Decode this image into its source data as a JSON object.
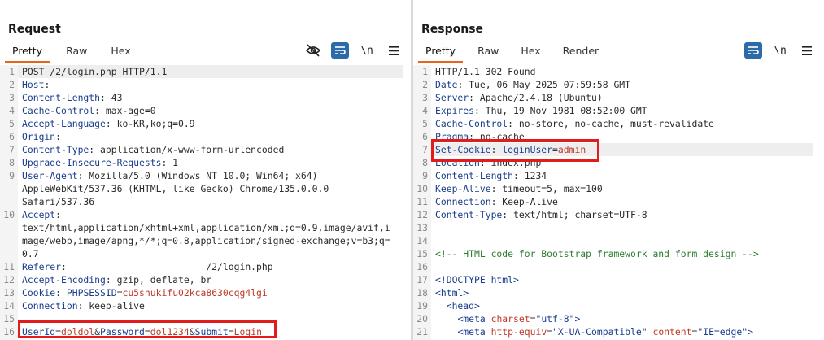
{
  "request": {
    "title": "Request",
    "tabs": [
      "Pretty",
      "Raw",
      "Hex"
    ],
    "active_tab": "Pretty",
    "newline_label": "\\n",
    "lines": [
      {
        "n": "1",
        "parts": [
          [
            "v",
            "POST /2/login.php HTTP/1.1"
          ]
        ]
      },
      {
        "n": "2",
        "parts": [
          [
            "k",
            "Host"
          ],
          [
            "v",
            ":"
          ]
        ]
      },
      {
        "n": "3",
        "parts": [
          [
            "k",
            "Content-Length"
          ],
          [
            "v",
            ": 43"
          ]
        ]
      },
      {
        "n": "4",
        "parts": [
          [
            "k",
            "Cache-Control"
          ],
          [
            "v",
            ": max-age=0"
          ]
        ]
      },
      {
        "n": "5",
        "parts": [
          [
            "k",
            "Accept-Language"
          ],
          [
            "v",
            ": ko-KR,ko;q=0.9"
          ]
        ]
      },
      {
        "n": "6",
        "parts": [
          [
            "k",
            "Origin"
          ],
          [
            "v",
            ":"
          ]
        ]
      },
      {
        "n": "7",
        "parts": [
          [
            "k",
            "Content-Type"
          ],
          [
            "v",
            ": application/x-www-form-urlencoded"
          ]
        ]
      },
      {
        "n": "8",
        "parts": [
          [
            "k",
            "Upgrade-Insecure-Requests"
          ],
          [
            "v",
            ": 1"
          ]
        ]
      },
      {
        "n": "9",
        "parts": [
          [
            "k",
            "User-Agent"
          ],
          [
            "v",
            ": Mozilla/5.0 (Windows NT 10.0; Win64; x64)"
          ]
        ]
      },
      {
        "n": "",
        "parts": [
          [
            "v",
            "AppleWebKit/537.36 (KHTML, like Gecko) Chrome/135.0.0.0"
          ]
        ]
      },
      {
        "n": "",
        "parts": [
          [
            "v",
            "Safari/537.36"
          ]
        ]
      },
      {
        "n": "10",
        "parts": [
          [
            "k",
            "Accept"
          ],
          [
            "v",
            ":"
          ]
        ]
      },
      {
        "n": "",
        "parts": [
          [
            "v",
            "text/html,application/xhtml+xml,application/xml;q=0.9,image/avif,i"
          ]
        ]
      },
      {
        "n": "",
        "parts": [
          [
            "v",
            "mage/webp,image/apng,*/*;q=0.8,application/signed-exchange;v=b3;q="
          ]
        ]
      },
      {
        "n": "",
        "parts": [
          [
            "v",
            "0.7"
          ]
        ]
      },
      {
        "n": "11",
        "parts": [
          [
            "k",
            "Referer"
          ],
          [
            "v",
            ":                         /2/login.php"
          ]
        ]
      },
      {
        "n": "12",
        "parts": [
          [
            "k",
            "Accept-Encoding"
          ],
          [
            "v",
            ": gzip, deflate, br"
          ]
        ]
      },
      {
        "n": "13",
        "parts": [
          [
            "k",
            "Cookie"
          ],
          [
            "v",
            ": "
          ],
          [
            "ck",
            "PHPSESSID"
          ],
          [
            "eq",
            "="
          ],
          [
            "cv",
            "cu5snukifu02kca8630cqg4lgi"
          ]
        ]
      },
      {
        "n": "14",
        "parts": [
          [
            "k",
            "Connection"
          ],
          [
            "v",
            ": keep-alive"
          ]
        ]
      },
      {
        "n": "15",
        "parts": []
      },
      {
        "n": "16",
        "parts": [
          [
            "pk",
            "UserId"
          ],
          [
            "eq",
            "="
          ],
          [
            "pv",
            "doldol"
          ],
          [
            "eq",
            "&"
          ],
          [
            "pk",
            "Password"
          ],
          [
            "eq",
            "="
          ],
          [
            "pv",
            "dol1234"
          ],
          [
            "eq",
            "&"
          ],
          [
            "pk",
            "Submit"
          ],
          [
            "eq",
            "="
          ],
          [
            "pv",
            "Login"
          ]
        ]
      }
    ]
  },
  "response": {
    "title": "Response",
    "tabs": [
      "Pretty",
      "Raw",
      "Hex",
      "Render"
    ],
    "active_tab": "Pretty",
    "newline_label": "\\n",
    "lines": [
      {
        "n": "1",
        "parts": [
          [
            "v",
            "HTTP/1.1 302 Found"
          ]
        ]
      },
      {
        "n": "2",
        "parts": [
          [
            "k",
            "Date"
          ],
          [
            "v",
            ": Tue, 06 May 2025 07:59:58 GMT"
          ]
        ]
      },
      {
        "n": "3",
        "parts": [
          [
            "k",
            "Server"
          ],
          [
            "v",
            ": Apache/2.4.18 (Ubuntu)"
          ]
        ]
      },
      {
        "n": "4",
        "parts": [
          [
            "k",
            "Expires"
          ],
          [
            "v",
            ": Thu, 19 Nov 1981 08:52:00 GMT"
          ]
        ]
      },
      {
        "n": "5",
        "parts": [
          [
            "k",
            "Cache-Control"
          ],
          [
            "v",
            ": no-store, no-cache, must-revalidate"
          ]
        ]
      },
      {
        "n": "6",
        "parts": [
          [
            "k",
            "Pragma"
          ],
          [
            "v",
            ": no-cache"
          ]
        ]
      },
      {
        "n": "7",
        "parts": [
          [
            "k",
            "Set-Cookie"
          ],
          [
            "v",
            ": "
          ],
          [
            "ck",
            "loginUser"
          ],
          [
            "eq",
            "="
          ],
          [
            "cv",
            "admin"
          ]
        ]
      },
      {
        "n": "8",
        "parts": [
          [
            "k",
            "Location"
          ],
          [
            "v",
            ": index.php"
          ]
        ]
      },
      {
        "n": "9",
        "parts": [
          [
            "k",
            "Content-Length"
          ],
          [
            "v",
            ": 1234"
          ]
        ]
      },
      {
        "n": "10",
        "parts": [
          [
            "k",
            "Keep-Alive"
          ],
          [
            "v",
            ": timeout=5, max=100"
          ]
        ]
      },
      {
        "n": "11",
        "parts": [
          [
            "k",
            "Connection"
          ],
          [
            "v",
            ": Keep-Alive"
          ]
        ]
      },
      {
        "n": "12",
        "parts": [
          [
            "k",
            "Content-Type"
          ],
          [
            "v",
            ": text/html; charset=UTF-8"
          ]
        ]
      },
      {
        "n": "13",
        "parts": []
      },
      {
        "n": "14",
        "parts": []
      },
      {
        "n": "15",
        "parts": [
          [
            "cm",
            "<!-- HTML code for Bootstrap framework and form design -->"
          ]
        ]
      },
      {
        "n": "16",
        "parts": []
      },
      {
        "n": "17",
        "parts": [
          [
            "tg",
            "<!DOCTYPE html>"
          ]
        ]
      },
      {
        "n": "18",
        "parts": [
          [
            "tg",
            "<html>"
          ]
        ]
      },
      {
        "n": "19",
        "parts": [
          [
            "v",
            "  "
          ],
          [
            "tg",
            "<head>"
          ]
        ]
      },
      {
        "n": "20",
        "parts": [
          [
            "v",
            "    "
          ],
          [
            "tg",
            "<meta "
          ],
          [
            "an",
            "charset"
          ],
          [
            "eq",
            "="
          ],
          [
            "av",
            "\"utf-8\""
          ],
          [
            "tg",
            ">"
          ]
        ]
      },
      {
        "n": "21",
        "parts": [
          [
            "v",
            "    "
          ],
          [
            "tg",
            "<meta "
          ],
          [
            "an",
            "http-equiv"
          ],
          [
            "eq",
            "="
          ],
          [
            "av",
            "\"X-UA-Compatible\""
          ],
          [
            "v",
            " "
          ],
          [
            "an",
            "content"
          ],
          [
            "eq",
            "="
          ],
          [
            "av",
            "\"IE=edge\""
          ],
          [
            "tg",
            ">"
          ]
        ]
      }
    ]
  }
}
